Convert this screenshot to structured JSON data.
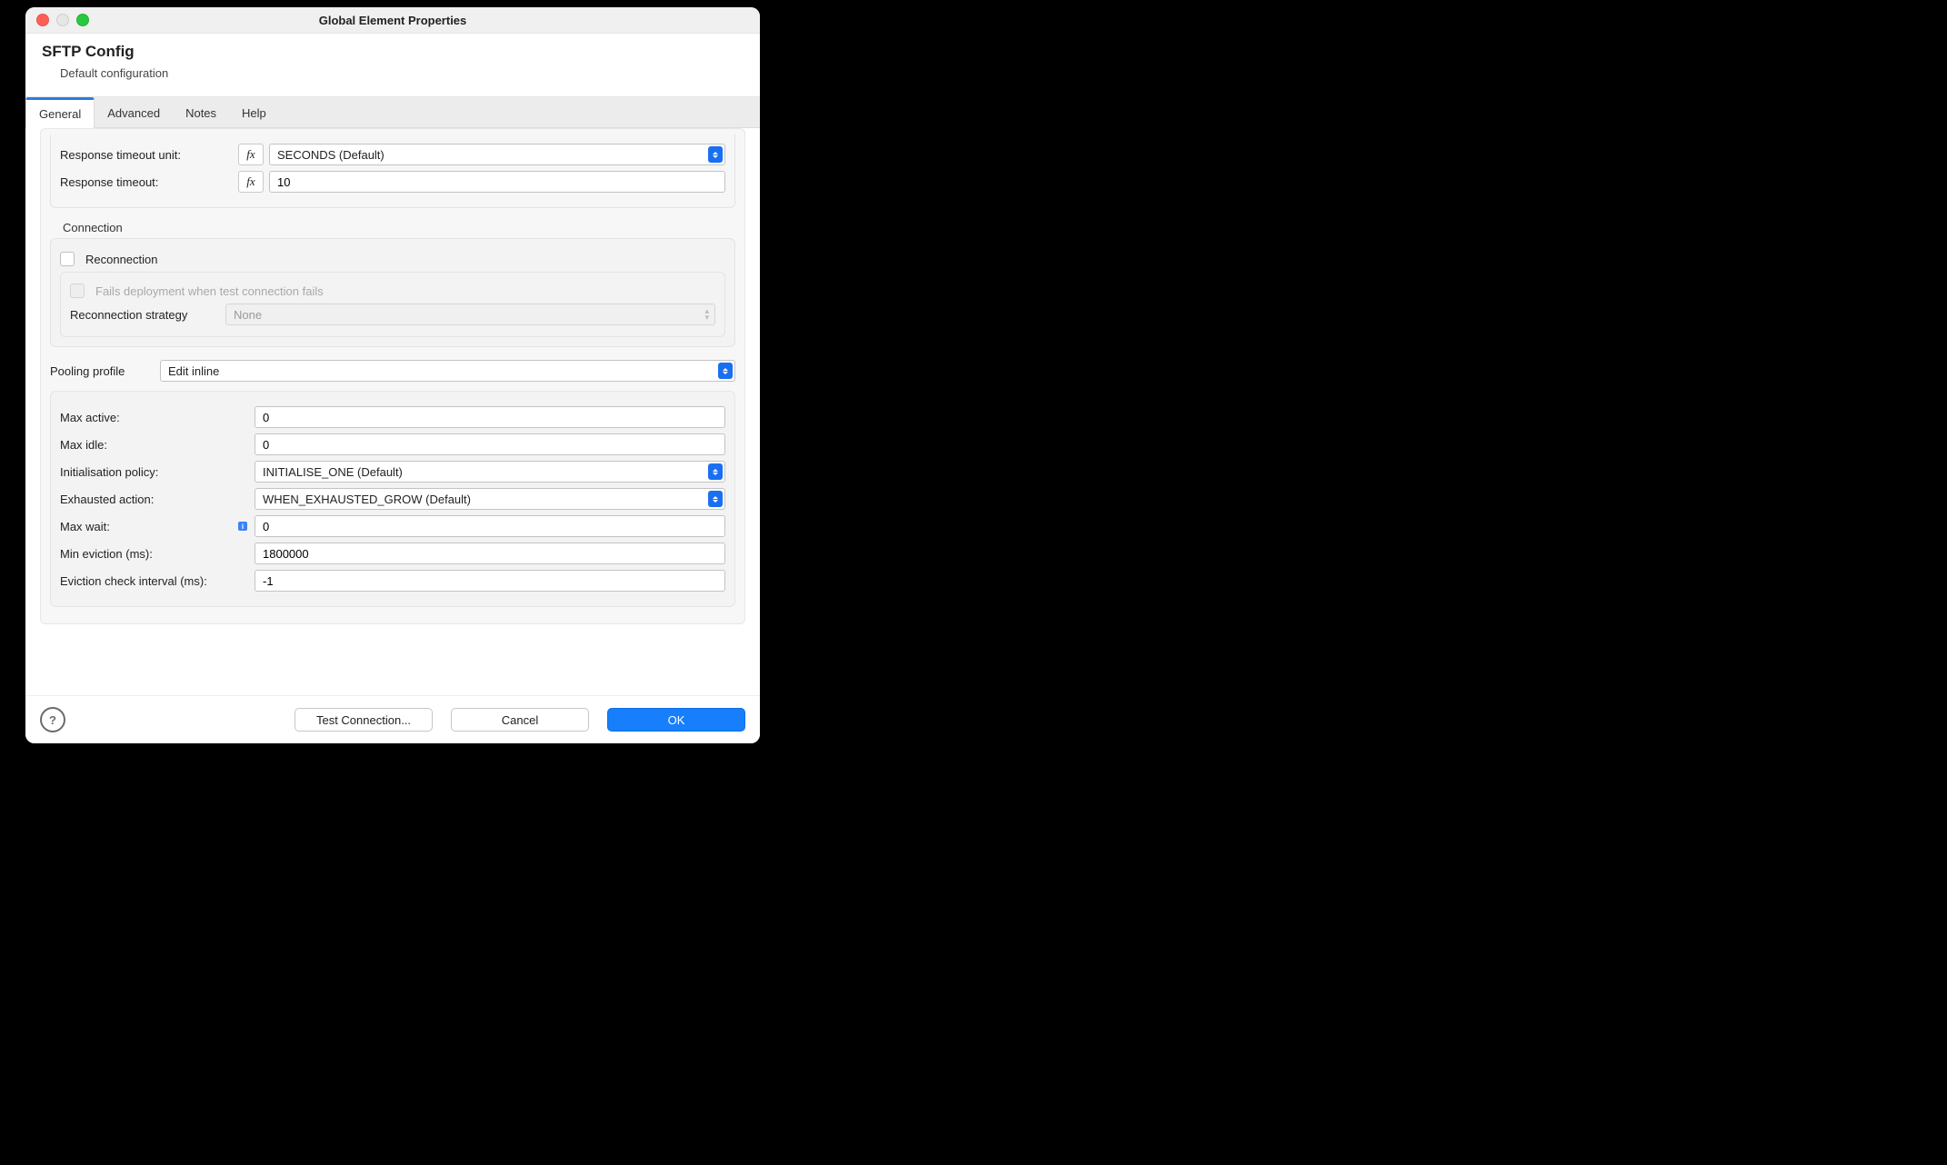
{
  "window": {
    "title": "Global Element Properties"
  },
  "header": {
    "name": "SFTP Config",
    "description": "Default configuration"
  },
  "tabs": {
    "general": "General",
    "advanced": "Advanced",
    "notes": "Notes",
    "help": "Help",
    "active": "general"
  },
  "timeout": {
    "unit_label": "Response timeout unit:",
    "unit_value": "SECONDS (Default)",
    "value_label": "Response timeout:",
    "value": "10",
    "fx": "fx"
  },
  "connection": {
    "section_label": "Connection",
    "reconnection_label": "Reconnection",
    "reconnection_checked": false,
    "fails_label": "Fails deployment when test connection fails",
    "fails_checked": false,
    "strategy_label": "Reconnection strategy",
    "strategy_value": "None"
  },
  "pooling": {
    "label": "Pooling profile",
    "value": "Edit inline",
    "grid": {
      "max_active": {
        "label": "Max active:",
        "value": "0"
      },
      "max_idle": {
        "label": "Max idle:",
        "value": "0"
      },
      "init_policy": {
        "label": "Initialisation policy:",
        "value": "INITIALISE_ONE (Default)"
      },
      "exhausted": {
        "label": "Exhausted action:",
        "value": "WHEN_EXHAUSTED_GROW (Default)"
      },
      "max_wait": {
        "label": "Max wait:",
        "value": "0"
      },
      "min_eviction": {
        "label": "Min eviction (ms):",
        "value": "1800000"
      },
      "eviction_interval": {
        "label": "Eviction check interval (ms):",
        "value": "-1"
      }
    }
  },
  "footer": {
    "test": "Test Connection...",
    "cancel": "Cancel",
    "ok": "OK"
  }
}
